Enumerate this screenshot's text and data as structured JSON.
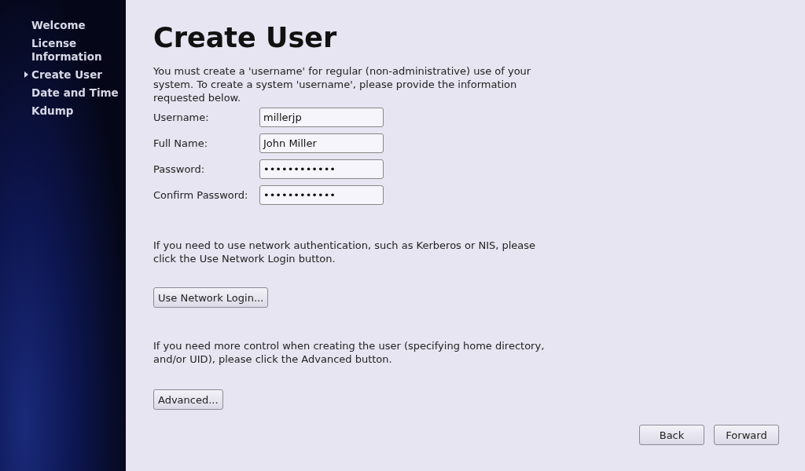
{
  "sidebar": {
    "items": [
      {
        "label": "Welcome",
        "selected": false
      },
      {
        "label": "License Information",
        "selected": false
      },
      {
        "label": "Create User",
        "selected": true
      },
      {
        "label": "Date and Time",
        "selected": false
      },
      {
        "label": "Kdump",
        "selected": false
      }
    ]
  },
  "title": "Create User",
  "intro": "You must create a 'username' for regular (non-administrative) use of your system.  To create a system 'username', please provide the information requested below.",
  "fields": [
    {
      "label": "Username:",
      "value": "millerjp"
    },
    {
      "label": "Full Name:",
      "value": "John Miller"
    },
    {
      "label": "Password:",
      "value": "••••••••••••"
    },
    {
      "label": "Confirm Password:",
      "value": "••••••••••••"
    }
  ],
  "network_text": "If you need to use network authentication, such as Kerberos or NIS, please click the Use Network Login button.",
  "network_button": "Use Network Login...",
  "advanced_text": "If you need more control when creating the user (specifying home directory, and/or UID), please click the Advanced button.",
  "advanced_button": "Advanced...",
  "buttons": [
    "Back",
    "Forward"
  ]
}
